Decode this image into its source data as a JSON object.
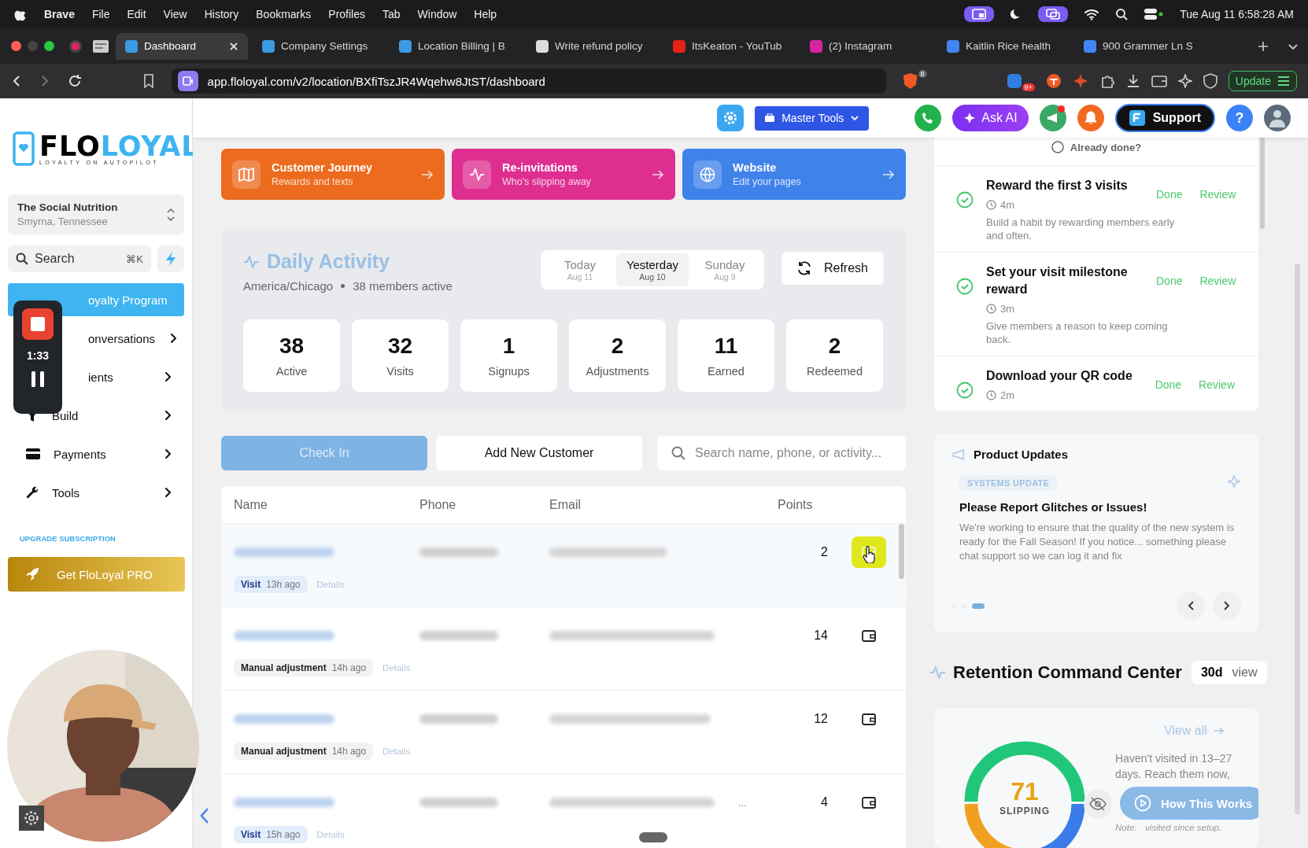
{
  "menu_bar": {
    "app": "Brave",
    "items": [
      "File",
      "Edit",
      "View",
      "History",
      "Bookmarks",
      "Profiles",
      "Tab",
      "Window",
      "Help"
    ],
    "clock": "Tue Aug 11  6:58:28 AM"
  },
  "browser_tabs": [
    {
      "title": "Dashboard",
      "selected": true,
      "color": "#3b9ae1"
    },
    {
      "title": "Company Settings",
      "selected": false,
      "color": "#3b9ae1"
    },
    {
      "title": "Location Billing | B",
      "selected": false,
      "color": "#3b9ae1"
    },
    {
      "title": "Write refund policy",
      "selected": false,
      "color": "#dddddd"
    },
    {
      "title": "ItsKeaton - YouTub",
      "selected": false,
      "color": "#e62117"
    },
    {
      "title": "(2) Instagram",
      "selected": false,
      "color": "#d6249f"
    },
    {
      "title": "Kaitlin Rice health",
      "selected": false,
      "color": "#4285f4"
    },
    {
      "title": "900 Grammer Ln S",
      "selected": false,
      "color": "#4285f4"
    }
  ],
  "address_bar": {
    "url": "app.floloyal.com/v2/location/BXfiTszJR4Wqehw8JtST/dashboard",
    "shield_badge": "8",
    "extension_badge": "9+",
    "update_button": "Update"
  },
  "header": {
    "master_tools": "Master Tools",
    "ask_ai": "Ask AI",
    "support": "Support",
    "help": "?"
  },
  "sidebar": {
    "logo": {
      "part_1": "FLO",
      "part_2": "LOYAL",
      "tagline": "LOYALTY ON AUTOPILOT"
    },
    "location": {
      "name": "The Social Nutrition",
      "city": "Smyrna, Tennessee"
    },
    "search": {
      "placeholder": "Search",
      "shortcut": "⌘K"
    },
    "nav": [
      {
        "label": "oyalty Program",
        "selected": true
      },
      {
        "label": "onversations",
        "selected": false
      },
      {
        "label": "ients",
        "selected": false
      },
      {
        "label": "Build",
        "selected": false
      },
      {
        "label": "Payments",
        "selected": false
      },
      {
        "label": "Tools",
        "selected": false
      }
    ],
    "upgrade_link": "UPGRADE SUBSCRIPTION",
    "pro_button": "Get FloLoyal PRO"
  },
  "recorder": {
    "time": "1:33"
  },
  "shortcuts": [
    {
      "title": "Customer Journey",
      "subtitle": "Rewards and texts",
      "color": "#ec6b1e"
    },
    {
      "title": "Re-invitations",
      "subtitle": "Who's slipping away",
      "color": "#de2f91"
    },
    {
      "title": "Website",
      "subtitle": "Edit your pages",
      "color": "#3f82ea"
    }
  ],
  "daily_activity": {
    "title": "Daily Activity",
    "timezone": "America/Chicago",
    "members": "38 members active",
    "days": [
      {
        "label": "Today",
        "date": "Aug 11",
        "selected": false
      },
      {
        "label": "Yesterday",
        "date": "Aug 10",
        "selected": true
      },
      {
        "label": "Sunday",
        "date": "Aug 9",
        "selected": false
      }
    ],
    "refresh": "Refresh",
    "stats": [
      {
        "value": "38",
        "label": "Active"
      },
      {
        "value": "32",
        "label": "Visits"
      },
      {
        "value": "1",
        "label": "Signups"
      },
      {
        "value": "2",
        "label": "Adjustments"
      },
      {
        "value": "11",
        "label": "Earned"
      },
      {
        "value": "2",
        "label": "Redeemed"
      }
    ]
  },
  "actions": {
    "check_in": "Check In",
    "add_customer": "Add New Customer",
    "search_placeholder": "Search name, phone, or activity..."
  },
  "table": {
    "columns": [
      "Name",
      "Phone",
      "Email",
      "Points"
    ],
    "rows": [
      {
        "points": "2",
        "tag": {
          "kind": "visit",
          "label": "Visit",
          "time": "13h ago"
        },
        "details": "Details",
        "selected": true
      },
      {
        "points": "14",
        "tag": {
          "kind": "adjustment",
          "label": "Manual adjustment",
          "time": "14h ago"
        },
        "details": "Details",
        "selected": false
      },
      {
        "points": "12",
        "tag": {
          "kind": "adjustment",
          "label": "Manual adjustment",
          "time": "14h ago"
        },
        "details": "Details",
        "selected": false
      },
      {
        "points": "4",
        "tag": {
          "kind": "visit",
          "label": "Visit",
          "time": "15h ago"
        },
        "details": "Details",
        "selected": false,
        "email_tail": "..."
      }
    ]
  },
  "checklist": {
    "header": "Already done?",
    "tasks": [
      {
        "title": "Reward the first 3 visits",
        "time": "4m",
        "description": "Build a habit by rewarding members early and often.",
        "done": true,
        "done_label": "Done",
        "review": "Review"
      },
      {
        "title": "Set your visit milestone reward",
        "time": "3m",
        "description": "Give members a reason to keep coming back.",
        "done": true,
        "done_label": "Done",
        "review": "Review"
      },
      {
        "title": "Download your QR code",
        "time": "2m",
        "done": true,
        "done_label": "Done",
        "review": "Review"
      }
    ]
  },
  "product_updates": {
    "title": "Product Updates",
    "tag": "SYSTEMS UPDATE",
    "headline": "Please Report Glitches or Issues!",
    "body": "We're working to ensure that the quality of the new system is ready for the Fall Season! If you notice... something please chat support so we can log it and fix",
    "pages": [
      {
        "selected": false
      },
      {
        "selected": false
      },
      {
        "selected": true
      }
    ]
  },
  "retention": {
    "title": "Retention Command Center",
    "range": "30d",
    "range_suffix": "view",
    "view_all": "View all",
    "donut_value": "71",
    "donut_label": "SLIPPING",
    "description": "Haven't visited in 13–27 days. Reach them now,",
    "note": "Note:",
    "note_tail": "visited since setup.",
    "how_button": "How This Works"
  }
}
